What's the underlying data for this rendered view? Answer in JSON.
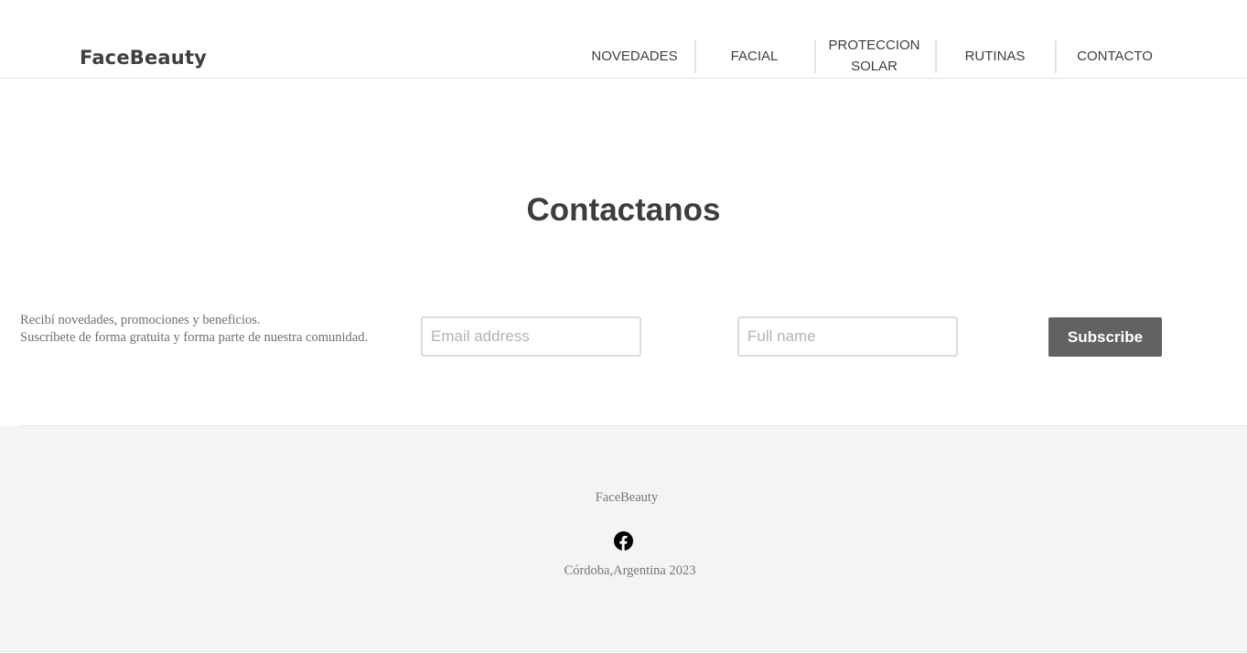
{
  "header": {
    "brand": "FaceBeauty",
    "nav": [
      {
        "label": "NOVEDADES"
      },
      {
        "label": "FACIAL"
      },
      {
        "label_line1": "PROTECCION",
        "label_line2": "SOLAR"
      },
      {
        "label": "RUTINAS"
      },
      {
        "label": "CONTACTO"
      }
    ]
  },
  "main": {
    "title": "Contactanos",
    "newsletter": {
      "line1": "Recibí novedades, promociones y beneficios.",
      "line2": "Suscríbete de forma gratuita y forma parte de nuestra comunidad.",
      "email_placeholder": "Email address",
      "name_placeholder": "Full name",
      "button_label": "Subscribe"
    }
  },
  "footer": {
    "brand": "FaceBeauty",
    "social_icon": "facebook-icon",
    "location": "Córdoba,Argentina 2023"
  },
  "colors": {
    "text": "#3d3d3d",
    "button_bg": "#626262",
    "footer_bg": "#f4f4f4"
  }
}
